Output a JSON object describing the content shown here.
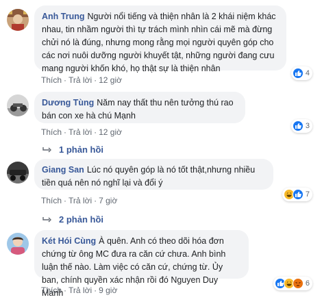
{
  "comments": [
    {
      "author": "Anh Trung",
      "text": "Người nổi tiếng và thiện nhân là 2 khái niệm khác nhau, tin nhầm người thì tự trách mình nhìn cái mẽ mà đừng chửi nó là đúng, nhưng mong rằng mọi người quyên góp cho các nơi nuôi dưỡng người khuyết tật, những người đang cưu mang người khốn khó, họ thật sự là thiện nhân",
      "like_label": "Thích",
      "reply_label": "Trả lời",
      "time": "12 giờ",
      "reaction_count": "4",
      "reactions": [
        "like-icon"
      ]
    },
    {
      "author": "Dương Tùng",
      "text": "Năm nay thất thu nên tưởng thú rao bán con xe hà chú Mạnh",
      "like_label": "Thích",
      "reply_label": "Trả lời",
      "time": "12 giờ",
      "reaction_count": "3",
      "reactions": [
        "like-icon"
      ],
      "replies": "1 phản hồi"
    },
    {
      "author": "Giang San",
      "text": "Lúc nó quyên góp là nó tốt thật,nhưng nhiều tiền quá nên nó nghĩ lại và đổi ý",
      "like_label": "Thích",
      "reply_label": "Trả lời",
      "time": "7 giờ",
      "reaction_count": "7",
      "reactions": [
        "haha-icon",
        "like-icon"
      ],
      "replies": "2 phản hồi"
    },
    {
      "author": "Két Hói Cùng",
      "text": "À quên. Anh có theo dõi hóa đơn chứng từ ông MC đưa ra căn cứ chưa. Anh bình luận thế nào. Làm việc có căn cứ, chứng từ. Ủy ban, chính quyền xác nhận rồi đó Nguyen Duy Manh",
      "like_label": "Thích",
      "reply_label": "Trả lời",
      "time": "9 giờ",
      "reaction_count": "6",
      "reactions": [
        "like-icon",
        "haha-icon",
        "angry-icon"
      ]
    }
  ],
  "colors": {
    "link": "#385898",
    "bubble": "#f2f3f5",
    "like": "#1877f2",
    "haha": "#f7b928",
    "angry": "#e9710f"
  }
}
